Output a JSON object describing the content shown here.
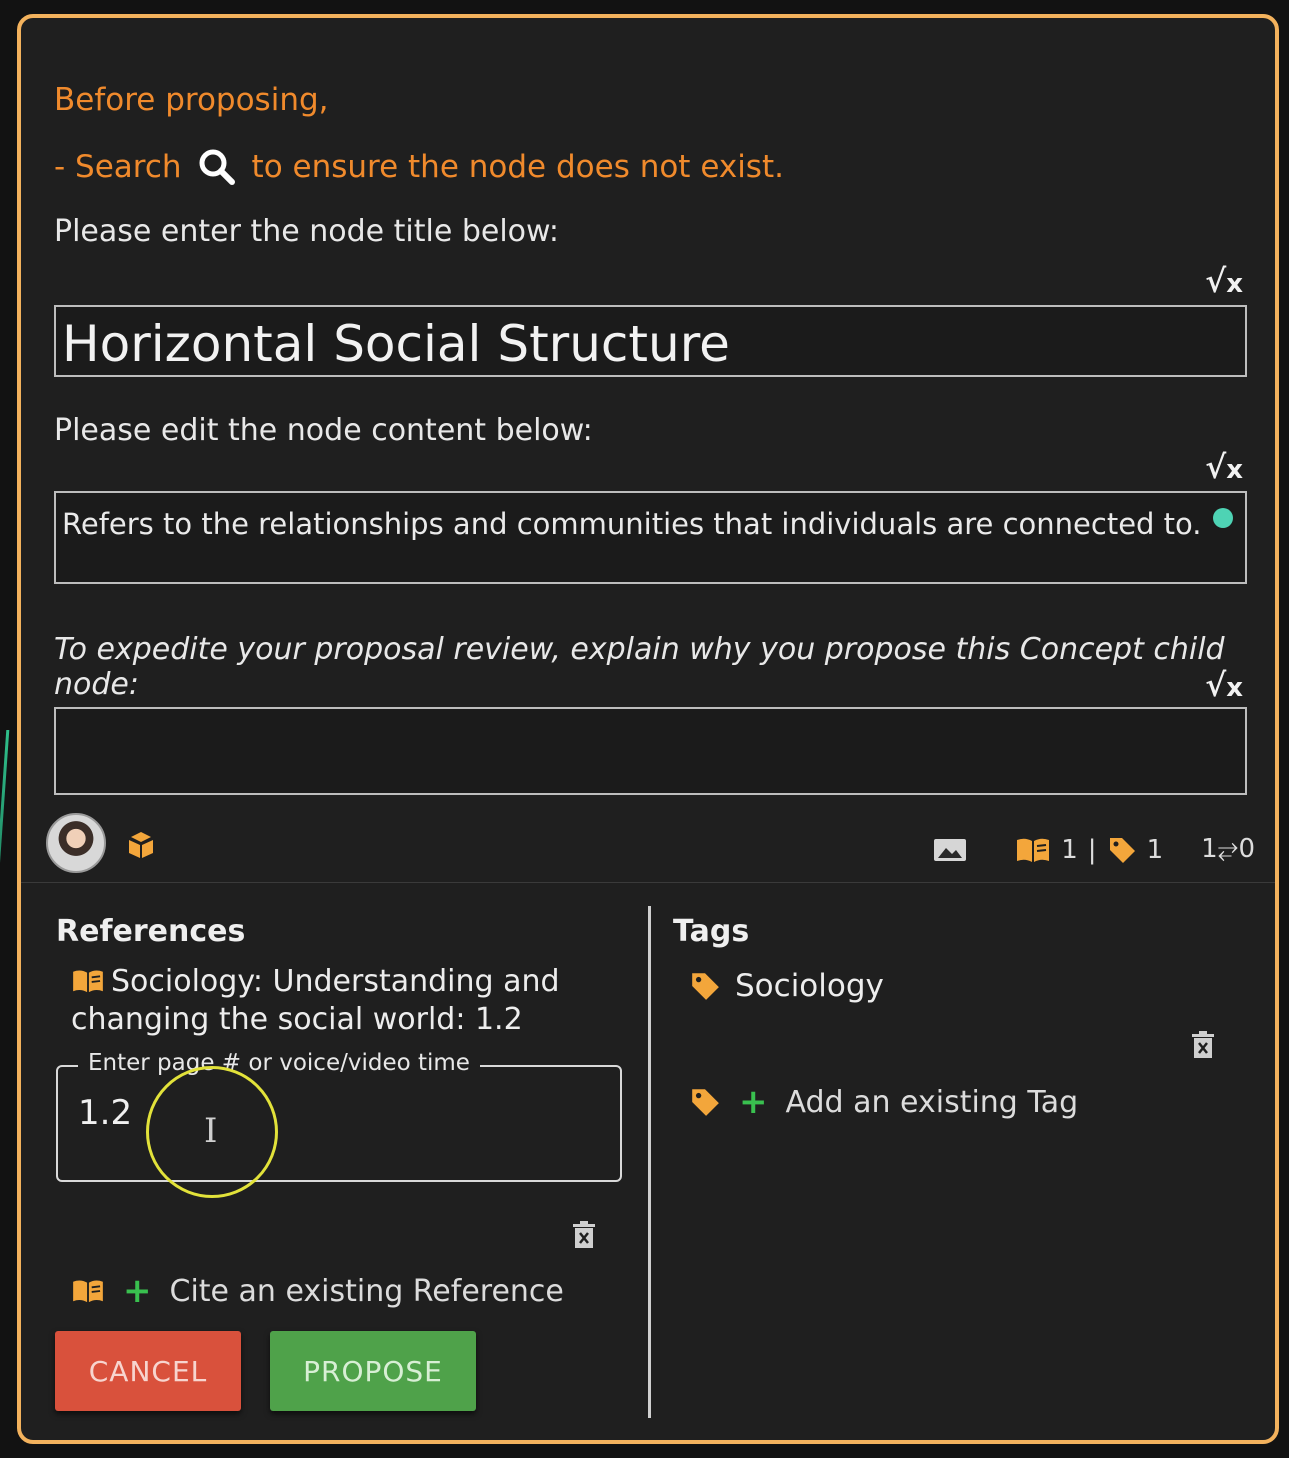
{
  "notice": {
    "line1": "Before proposing,",
    "line2_prefix": "- Search",
    "line2_suffix": "to ensure the node does not exist."
  },
  "title_section": {
    "label": "Please enter the node title below:",
    "value": "Horizontal Social Structure"
  },
  "content_section": {
    "label": "Please edit the node content below:",
    "value": "Refers to the relationships and communities that individuals are connected to."
  },
  "reason_section": {
    "label": "To expedite your proposal review, explain why you propose this Concept child node:",
    "value": ""
  },
  "math_button_label": "√x",
  "stats": {
    "references_count": "1",
    "separator": "|",
    "tags_count": "1",
    "links": "1⥂0"
  },
  "references": {
    "heading": "References",
    "items": [
      {
        "title": "Sociology: Understanding and changing the social world: 1.2"
      }
    ],
    "page_field_legend": "Enter page # or voice/video time",
    "page_field_value": "1.2",
    "cite_label": "Cite an existing Reference"
  },
  "tags": {
    "heading": "Tags",
    "items": [
      {
        "label": "Sociology"
      }
    ],
    "add_label": "Add an existing Tag"
  },
  "buttons": {
    "cancel": "CANCEL",
    "propose": "PROPOSE"
  },
  "colors": {
    "accent_orange": "#f08a2c",
    "card_border": "#f3b25d",
    "cancel_red": "#d9513c",
    "propose_green": "#4fa24a",
    "plus_green": "#39c04f"
  },
  "icons": [
    "search-icon",
    "math-editor-icon",
    "avatar",
    "proposal-icon",
    "image-icon",
    "reference-icon",
    "tag-icon",
    "trash-icon",
    "add-icon"
  ]
}
